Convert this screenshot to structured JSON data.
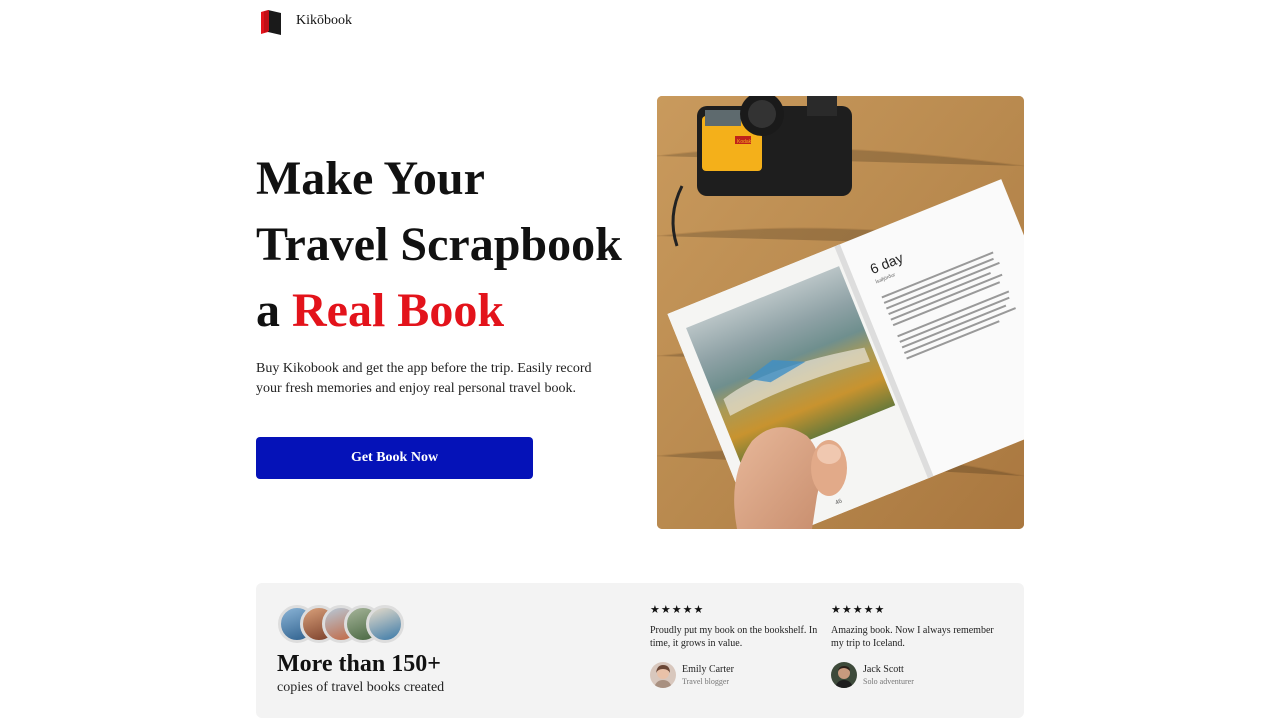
{
  "brand": {
    "name": "Kikōbook"
  },
  "hero": {
    "title_line1": "Make Your",
    "title_line2": "Travel Scrapbook",
    "title_line3_prefix": "a ",
    "title_line3_accent": "Real Book",
    "subtitle": "Buy Kikobook and get the app before the trip. Easily record your fresh memories and enjoy real personal travel book.",
    "cta_label": "Get Book Now",
    "photo": {
      "book_heading": "6 day",
      "book_subheading": "Ísafjörður",
      "page_number": "46",
      "camera_brand": "Kodak"
    }
  },
  "stats": {
    "title": "More than 150+",
    "subtitle": "copies of travel books created"
  },
  "reviews": [
    {
      "stars": "★★★★★",
      "quote": "Proudly put my book on the bookshelf. In time, it grows in value.",
      "name": "Emily Carter",
      "role": "Travel blogger"
    },
    {
      "stars": "★★★★★",
      "quote": "Amazing book. Now I always remember my trip to Iceland.",
      "name": "Jack Scott",
      "role": "Solo adventurer"
    }
  ],
  "colors": {
    "accent_red": "#e3131b",
    "cta_blue": "#0512b8",
    "panel_bg": "#f3f3f3"
  }
}
